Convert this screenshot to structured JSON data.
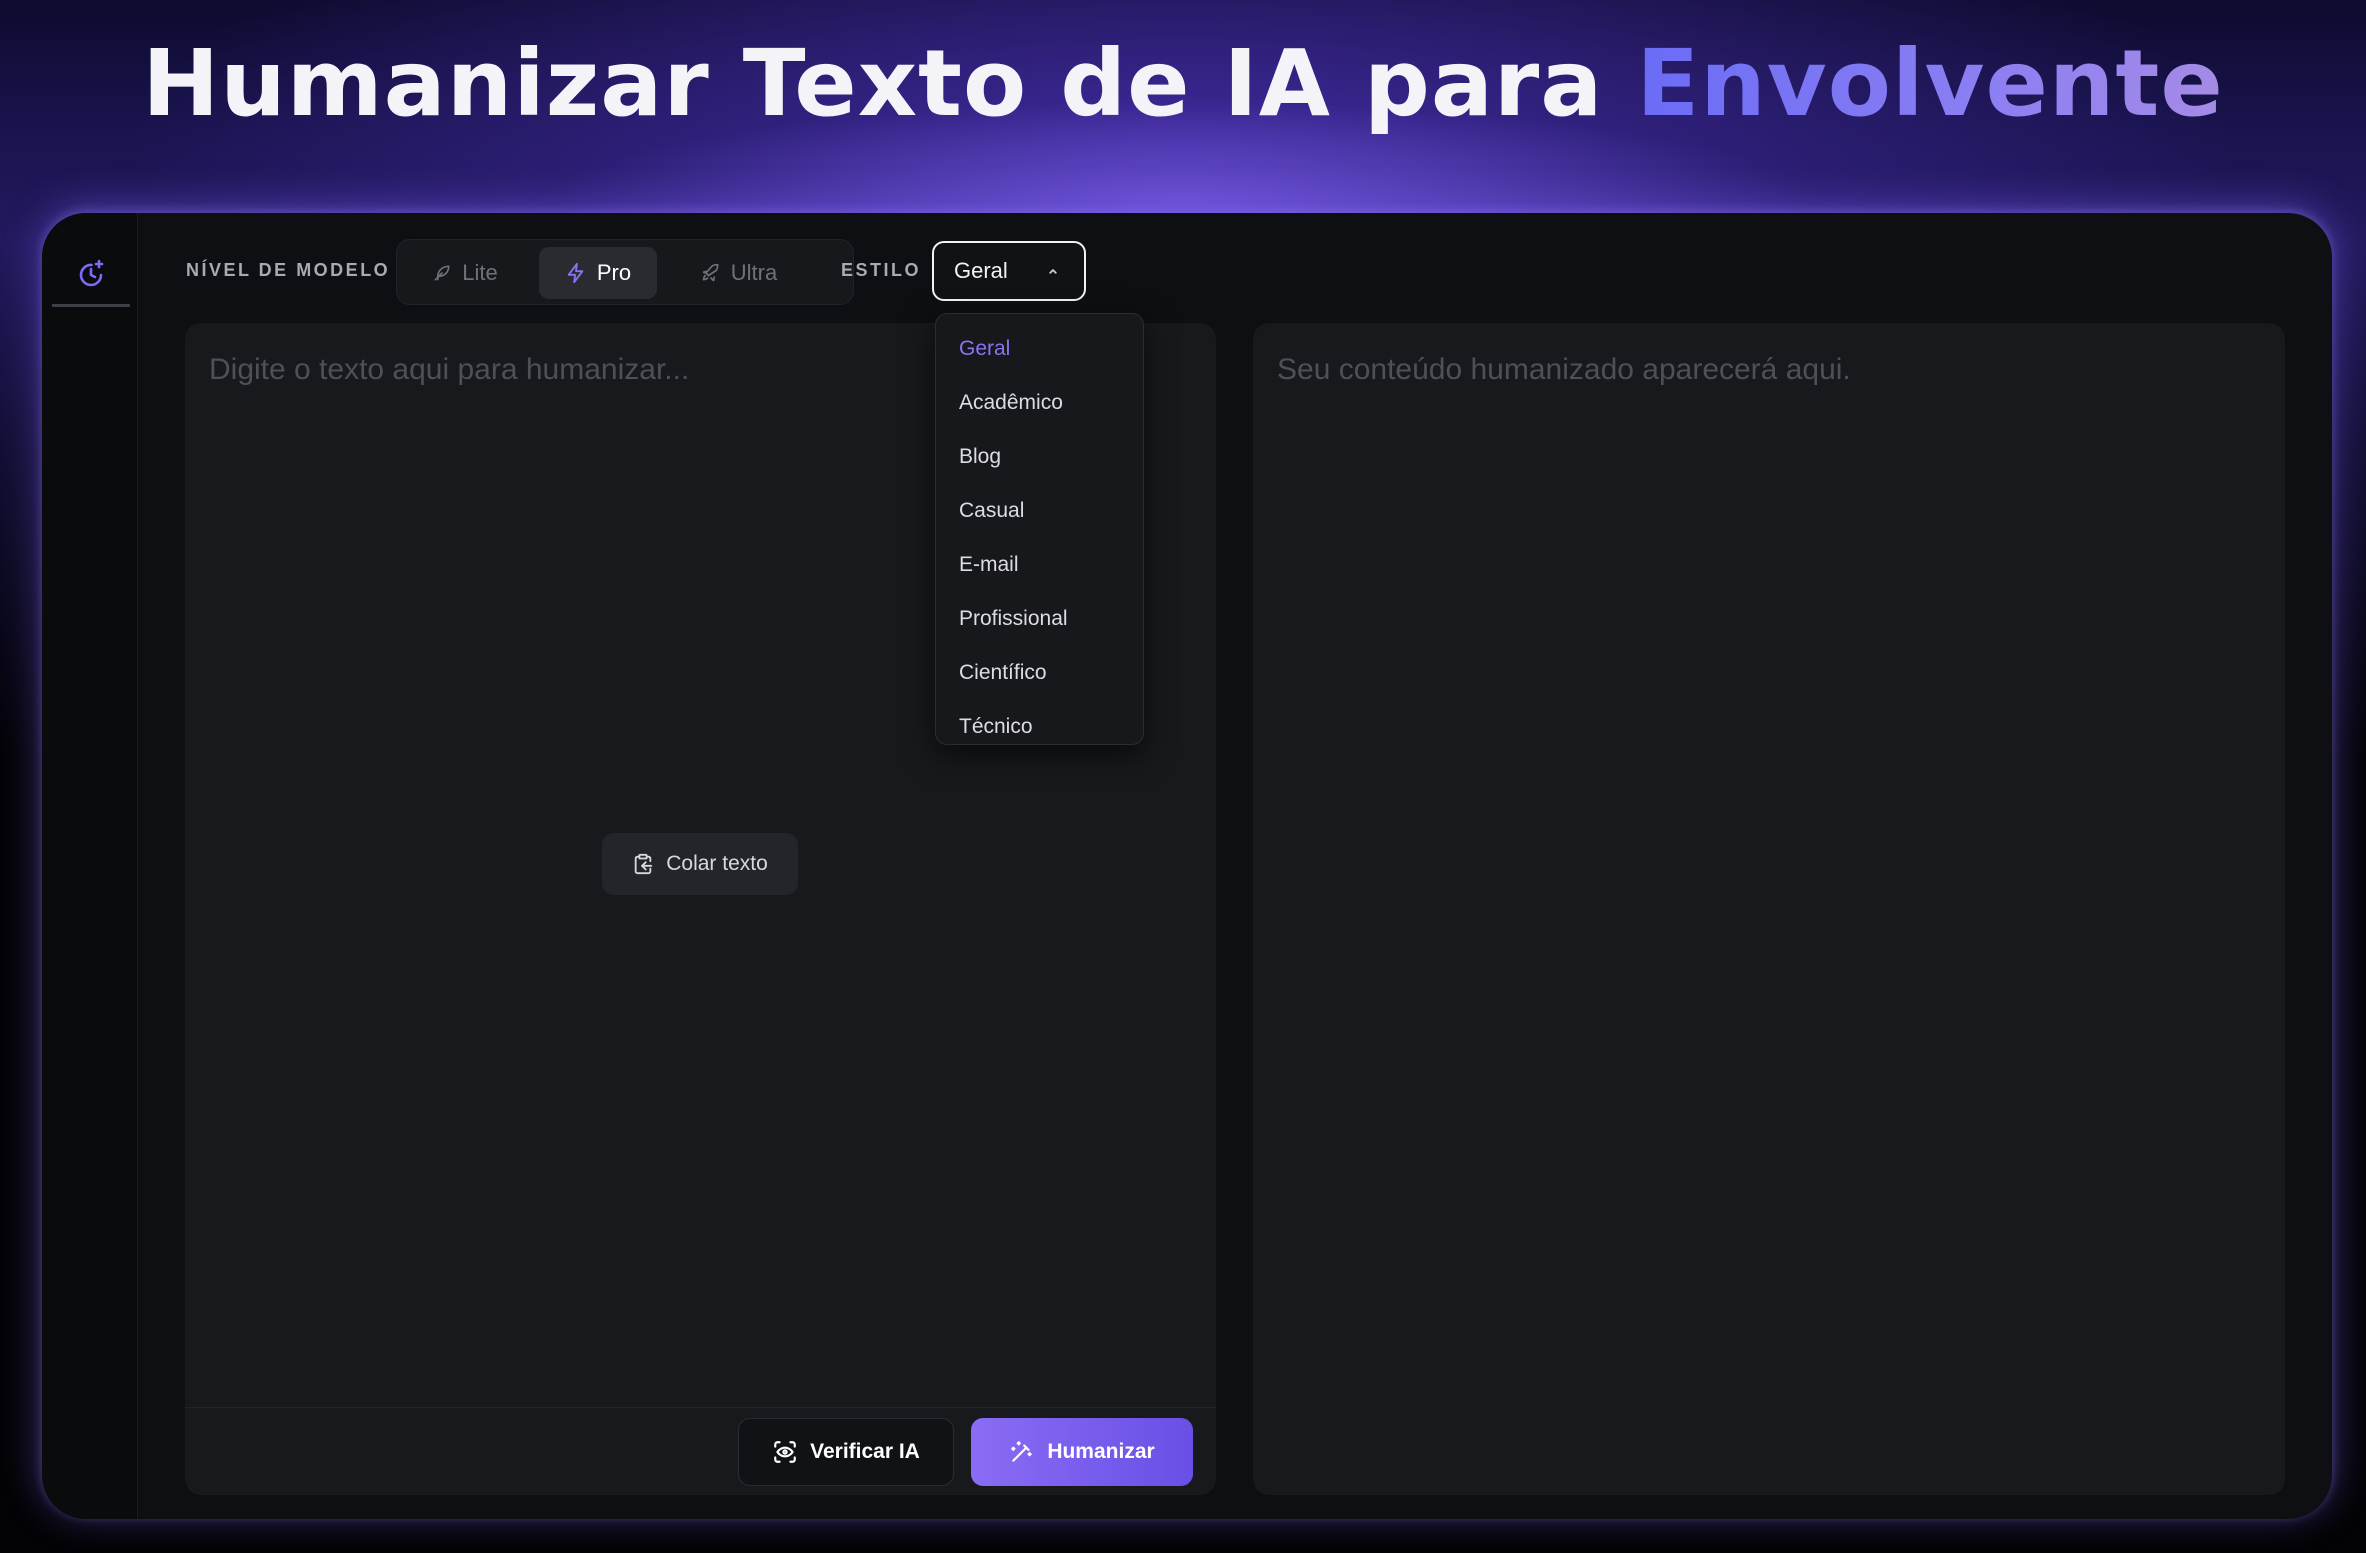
{
  "hero": {
    "title_main": "Humanizar Texto de IA para ",
    "title_accent": "Envolvente"
  },
  "sidebar": {
    "active_icon": "history-sparkle-icon"
  },
  "toolbar": {
    "model_label": "NÍVEL DE MODELO",
    "models": [
      {
        "label": "Lite",
        "icon": "feather-icon",
        "active": false
      },
      {
        "label": "Pro",
        "icon": "lightning-icon",
        "active": true
      },
      {
        "label": "Ultra",
        "icon": "rocket-icon",
        "active": false
      }
    ],
    "style_label": "ESTILO",
    "style_selected": "Geral"
  },
  "style_dropdown": {
    "options": [
      "Geral",
      "Acadêmico",
      "Blog",
      "Casual",
      "E-mail",
      "Profissional",
      "Científico",
      "Técnico"
    ],
    "selected": "Geral"
  },
  "input_panel": {
    "placeholder": "Digite o texto aqui para humanizar...",
    "paste_label": "Colar texto",
    "check_label": "Verificar IA",
    "humanize_label": "Humanizar"
  },
  "output_panel": {
    "placeholder": "Seu conteúdo humanizado aparecerá aqui."
  },
  "colors": {
    "accent": "#8a6cf4",
    "accent_dark": "#6a4fe6",
    "background": "#0e0f12",
    "panel": "#18191c"
  }
}
